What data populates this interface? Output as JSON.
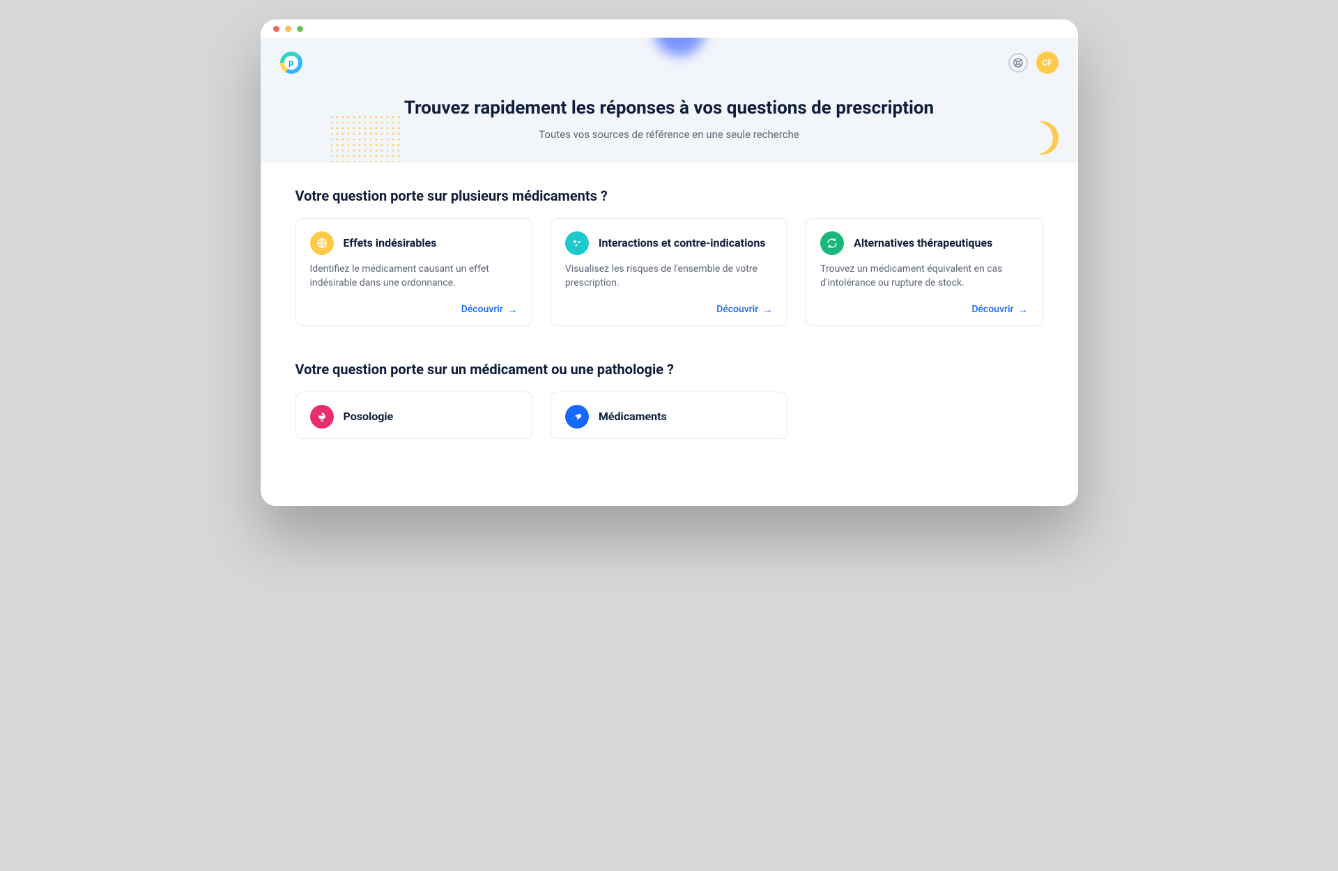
{
  "header": {
    "avatar_initials": "CF"
  },
  "hero": {
    "title": "Trouvez rapidement les réponses à vos questions de prescription",
    "subtitle": "Toutes vos sources de référence en une seule recherche"
  },
  "section_multi": {
    "title": "Votre question porte sur plusieurs médicaments ?",
    "cards": [
      {
        "icon": "globe-icon",
        "icon_color": "yellow",
        "title": "Effets indésirables",
        "desc": "Identifiez le médicament causant un effet indésirable dans une ordonnance.",
        "link": "Découvrir"
      },
      {
        "icon": "molecule-icon",
        "icon_color": "teal",
        "title": "Interactions et contre-indications",
        "desc": "Visualisez les risques de l'ensemble de votre prescription.",
        "link": "Découvrir"
      },
      {
        "icon": "swap-icon",
        "icon_color": "green",
        "title": "Alternatives thérapeutiques",
        "desc": "Trouvez un médicament équivalent en cas d'intolérance ou rupture de stock.",
        "link": "Découvrir"
      }
    ]
  },
  "section_single": {
    "title": "Votre question porte sur un médicament ou une pathologie ?",
    "cards": [
      {
        "icon": "mortar-icon",
        "icon_color": "pink",
        "title": "Posologie"
      },
      {
        "icon": "pill-icon",
        "icon_color": "blue",
        "title": "Médicaments"
      }
    ]
  },
  "link_arrow": "→"
}
